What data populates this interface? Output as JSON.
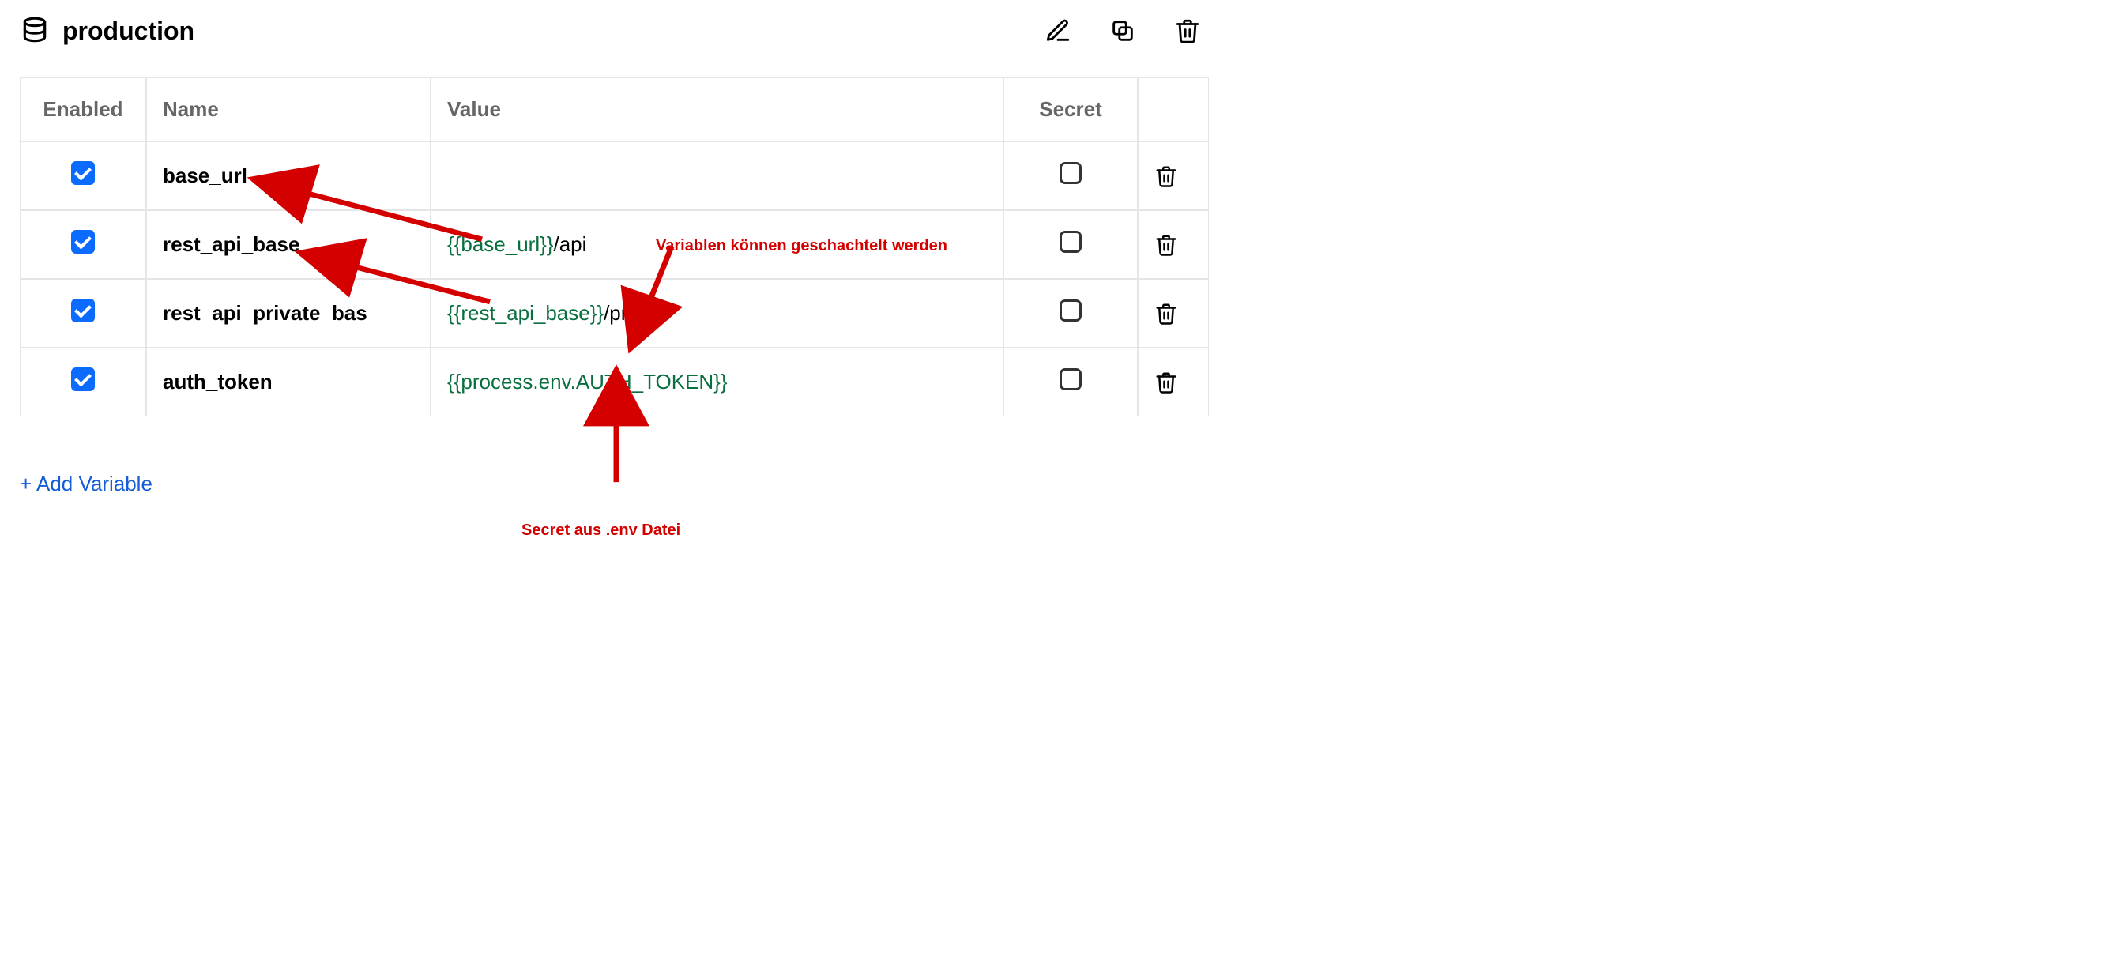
{
  "header": {
    "title": "production"
  },
  "columns": {
    "enabled": "Enabled",
    "name": "Name",
    "value": "Value",
    "secret": "Secret"
  },
  "rows": [
    {
      "enabled": true,
      "name": "base_url",
      "value_parts": [],
      "secret": false
    },
    {
      "enabled": true,
      "name": "rest_api_base",
      "value_parts": [
        {
          "type": "template",
          "text": "{{base_url}}"
        },
        {
          "type": "plain",
          "text": "/api"
        }
      ],
      "secret": false
    },
    {
      "enabled": true,
      "name": "rest_api_private_bas",
      "value_parts": [
        {
          "type": "template",
          "text": "{{rest_api_base}}"
        },
        {
          "type": "plain",
          "text": "/private"
        }
      ],
      "secret": false
    },
    {
      "enabled": true,
      "name": "auth_token",
      "value_parts": [
        {
          "type": "template",
          "text": "{{process.env.AUTH_TOKEN}}"
        }
      ],
      "secret": false
    }
  ],
  "actions": {
    "add_variable": "+ Add Variable"
  },
  "annotations": {
    "nested": "Variablen können geschachtelt werden",
    "secret_env": "Secret aus .env Datei"
  },
  "icons": {
    "database": "database-icon",
    "edit": "edit-icon",
    "copy": "copy-icon",
    "trash": "trash-icon",
    "checkbox_checked": "checkbox-checked-icon",
    "checkbox_unchecked": "checkbox-unchecked-icon"
  },
  "colors": {
    "template_text": "#0a6f3f",
    "link": "#155cd6",
    "annotation": "#d40000",
    "checkbox": "#0b6bff"
  }
}
